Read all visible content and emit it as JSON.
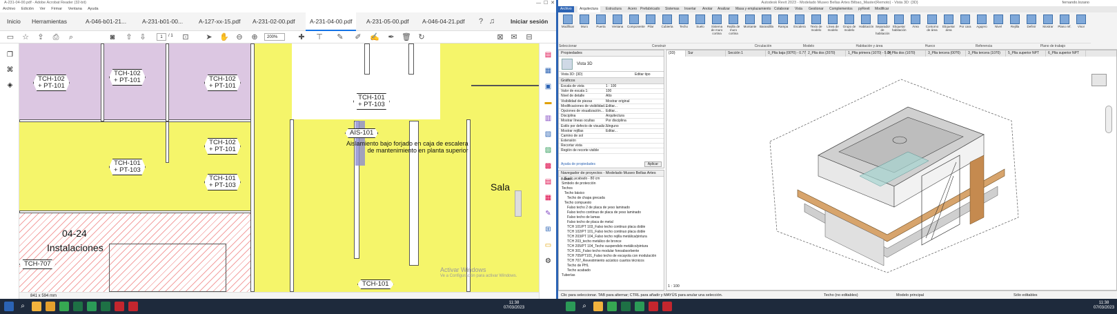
{
  "acrobat": {
    "title": "A-231-04-00.pdf - Adobe Acrobat Reader (32-bit)",
    "menu": [
      "Archivo",
      "Edición",
      "Ver",
      "Firmar",
      "Ventana",
      "Ayuda"
    ],
    "tabs": [
      "Inicio",
      "Herramientas",
      "A-046-b01-21...",
      "A-231-b01-00...",
      "A-127-xx-15.pdf",
      "A-231-02-00.pdf",
      "A-231-04-00.pdf",
      "A-231-05-00.pdf",
      "A-046-04-21.pdf"
    ],
    "signin": "Iniciar sesión",
    "page_current": "1",
    "page_total": "/ 1",
    "zoom": "200%",
    "status": "841 x 594 mm",
    "drawing": {
      "tags": [
        "TCH-102\n+ PT-101",
        "TCH-102\n+ PT-101",
        "TCH-102\n+ PT-101",
        "TCH-101\n+ PT-103",
        "TCH-102\n+ PT-101",
        "TCH-101\n+ PT-103",
        "TCH-101\n+ PT-103",
        "AIS-101",
        "TCH-707",
        "TCH-101"
      ],
      "note": "Aislamiento bajo forjado en caja de escalera\nde mantenimiento en planta superior",
      "room_number": "04-24",
      "room_name": "Instalaciones",
      "sala": "Sala",
      "watermark1": "Activar Windows",
      "watermark2": "Ve a Configuración para activar Windows."
    }
  },
  "revit": {
    "title": "Autodesk Revit 2023 - Modelado Museo Bellas Artes Bilbao_Master(Remoto) - Vista 3D: {3D}",
    "user": "fernando.lozano",
    "ribbon_tabs": [
      "Archivo",
      "Arquitectura",
      "Estructura",
      "Acero",
      "Prefabricado",
      "Sistemas",
      "Insertar",
      "Anotar",
      "Analizar",
      "Masa y emplazamiento",
      "Colaborar",
      "Vista",
      "Gestionar",
      "Complementos",
      "pyRevit",
      "Modificar"
    ],
    "buttons": [
      "Modificar",
      "Muro",
      "Puerta",
      "Ventana",
      "Componente",
      "Pilar",
      "Cubierta",
      "Techo",
      "Suelo",
      "Sistema de muro cortina",
      "Rejilla de muro cortina",
      "Montante",
      "Barandilla",
      "Rampa",
      "Escalera",
      "Texto de modelo",
      "Línea de modelo",
      "Grupo de modelo",
      "Habitación",
      "Separador de habitación",
      "Etiquetar habitación",
      "Área",
      "Contorno de área",
      "Etiquetar área",
      "Por cara",
      "Agujero",
      "Nivel",
      "Rejilla",
      "Definir",
      "Mostrar",
      "Plano ref.",
      "Visor"
    ],
    "groups": [
      "Seleccionar",
      "Construir",
      "Circulación",
      "Modelo",
      "Habitación y área",
      "Hueco",
      "Referencia",
      "Plano de trabajo"
    ],
    "properties": {
      "header": "Propiedades",
      "type": "Vista 3D",
      "view_selector": "Vista 3D: {3D}",
      "edit_type": "Editar tipo",
      "section": "Gráficos",
      "rows": [
        [
          "Escala de vista",
          "1 : 100"
        ],
        [
          "Valor de escala 1:",
          "100"
        ],
        [
          "Nivel de detalle",
          "Alto"
        ],
        [
          "Visibilidad de piezas",
          "Mostrar original"
        ],
        [
          "Modificaciones de visibilidad...",
          "Editar..."
        ],
        [
          "Opciones de visualización...",
          "Editar..."
        ],
        [
          "Disciplina",
          "Arquitectura"
        ],
        [
          "Mostrar líneas ocultas",
          "Por disciplina"
        ],
        [
          "Estilo por defecto de visualiz...",
          "Ninguno"
        ],
        [
          "Mostrar rejillas",
          "Editar..."
        ],
        [
          "Camino de sol",
          ""
        ],
        [
          "Extensión",
          ""
        ],
        [
          "Recortar vista",
          ""
        ],
        [
          "Región de recorte visible",
          ""
        ]
      ],
      "help": "Ayuda de propiedades",
      "apply": "Aplicar"
    },
    "browser": {
      "header": "Navegador de proyectos - Modelado Museo Bellas Artes Bilbao...",
      "items": [
        "Suelo acabado - 80 cm",
        "Simbolo de protección",
        "Techos",
        "Techo básico",
        "Techo de chapa grecada",
        "Techo compuesto",
        "Falso techo 2 de placa de yeso laminado",
        "Falso techo continuo de placa de yeso laminado",
        "Falso techo de lamas",
        "Falso techo de placa de metal",
        "TCH 101/PT 103_Falso techo continuo placa doble",
        "TCH 102/PT 101_Falso techo continuo placa doble",
        "TCH 203/PT 104_Falso techo rejilla metálica/pintura",
        "TCH 203_techo metálico de bronce",
        "TCH 205/PT 104_Techo suspendido metálico/pintura",
        "TCH 301_Falso techo modular fonoabsorbente",
        "TCH 705/PT101_Falso techo de escayola con modulación",
        "TCH 707_Revestimiento acústico cuartos técnicos",
        "Techo de PHL",
        "Techo acabado",
        "Tuberías"
      ]
    },
    "view_tabs": [
      "{3D}",
      "Sur",
      "Sección 1",
      "0_Plta baja (00?0) - 0.77",
      "2_Plta dos (2070)",
      "1_Plta primera (1070) - 5.84",
      "2_Plta dos (1070)",
      "3_Plta tercera (00?0)",
      "3_Plta tercera (1070)",
      "5_Plta superior NPT",
      "6_Plta superior NPT"
    ],
    "view_scale": "1 : 100",
    "status": "Clic para seleccionar. TAB para alternar; CTRL para añadir y MAYÚS para anular una selección.",
    "status_type": "Techo (no editables)",
    "status_model": "Modelo principal",
    "status_sel": "Sólo editables"
  },
  "taskbar": {
    "time1": "11:38",
    "date1": "07/03/2023",
    "time2": "11:38",
    "date2": "07/03/2023"
  },
  "colors": {
    "accent": "#2b63b4",
    "plan_yellow": "#f5f56a",
    "plan_purple": "#dcc7e2",
    "hatch_red": "#f3a0a0"
  }
}
